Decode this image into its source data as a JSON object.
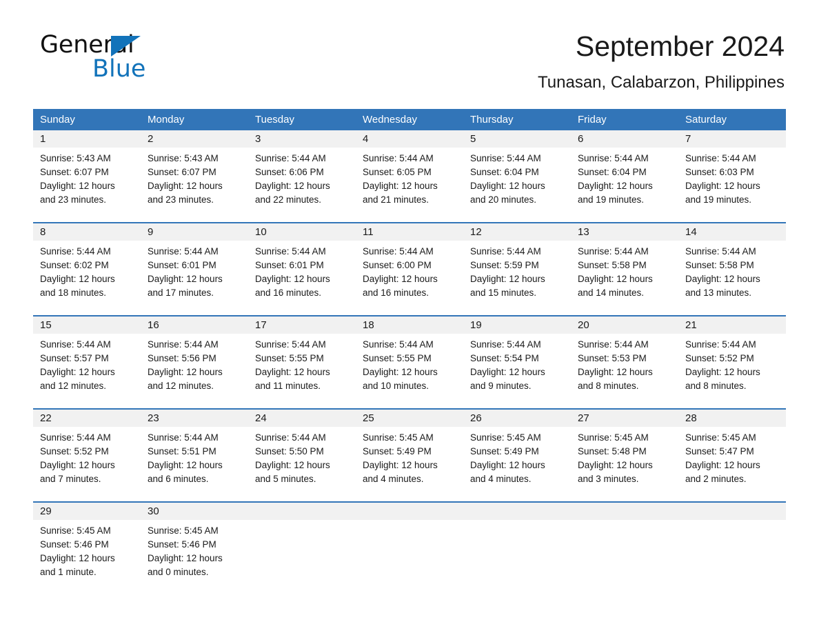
{
  "brand": {
    "name_part1": "General",
    "name_part2": "Blue",
    "triangle_color": "#1273ba"
  },
  "header": {
    "title": "September 2024",
    "subtitle": "Tunasan, Calabarzon, Philippines"
  },
  "colors": {
    "header_blue": "#3275b8",
    "daynum_band": "#f1f1f1",
    "separator_blue": "#3275b8",
    "brand_blue": "#1273ba"
  },
  "weekday_headers": [
    "Sunday",
    "Monday",
    "Tuesday",
    "Wednesday",
    "Thursday",
    "Friday",
    "Saturday"
  ],
  "weeks": [
    [
      {
        "day": "1",
        "sunrise": "Sunrise: 5:43 AM",
        "sunset": "Sunset: 6:07 PM",
        "daylight_line1": "Daylight: 12 hours",
        "daylight_line2": "and 23 minutes."
      },
      {
        "day": "2",
        "sunrise": "Sunrise: 5:43 AM",
        "sunset": "Sunset: 6:07 PM",
        "daylight_line1": "Daylight: 12 hours",
        "daylight_line2": "and 23 minutes."
      },
      {
        "day": "3",
        "sunrise": "Sunrise: 5:44 AM",
        "sunset": "Sunset: 6:06 PM",
        "daylight_line1": "Daylight: 12 hours",
        "daylight_line2": "and 22 minutes."
      },
      {
        "day": "4",
        "sunrise": "Sunrise: 5:44 AM",
        "sunset": "Sunset: 6:05 PM",
        "daylight_line1": "Daylight: 12 hours",
        "daylight_line2": "and 21 minutes."
      },
      {
        "day": "5",
        "sunrise": "Sunrise: 5:44 AM",
        "sunset": "Sunset: 6:04 PM",
        "daylight_line1": "Daylight: 12 hours",
        "daylight_line2": "and 20 minutes."
      },
      {
        "day": "6",
        "sunrise": "Sunrise: 5:44 AM",
        "sunset": "Sunset: 6:04 PM",
        "daylight_line1": "Daylight: 12 hours",
        "daylight_line2": "and 19 minutes."
      },
      {
        "day": "7",
        "sunrise": "Sunrise: 5:44 AM",
        "sunset": "Sunset: 6:03 PM",
        "daylight_line1": "Daylight: 12 hours",
        "daylight_line2": "and 19 minutes."
      }
    ],
    [
      {
        "day": "8",
        "sunrise": "Sunrise: 5:44 AM",
        "sunset": "Sunset: 6:02 PM",
        "daylight_line1": "Daylight: 12 hours",
        "daylight_line2": "and 18 minutes."
      },
      {
        "day": "9",
        "sunrise": "Sunrise: 5:44 AM",
        "sunset": "Sunset: 6:01 PM",
        "daylight_line1": "Daylight: 12 hours",
        "daylight_line2": "and 17 minutes."
      },
      {
        "day": "10",
        "sunrise": "Sunrise: 5:44 AM",
        "sunset": "Sunset: 6:01 PM",
        "daylight_line1": "Daylight: 12 hours",
        "daylight_line2": "and 16 minutes."
      },
      {
        "day": "11",
        "sunrise": "Sunrise: 5:44 AM",
        "sunset": "Sunset: 6:00 PM",
        "daylight_line1": "Daylight: 12 hours",
        "daylight_line2": "and 16 minutes."
      },
      {
        "day": "12",
        "sunrise": "Sunrise: 5:44 AM",
        "sunset": "Sunset: 5:59 PM",
        "daylight_line1": "Daylight: 12 hours",
        "daylight_line2": "and 15 minutes."
      },
      {
        "day": "13",
        "sunrise": "Sunrise: 5:44 AM",
        "sunset": "Sunset: 5:58 PM",
        "daylight_line1": "Daylight: 12 hours",
        "daylight_line2": "and 14 minutes."
      },
      {
        "day": "14",
        "sunrise": "Sunrise: 5:44 AM",
        "sunset": "Sunset: 5:58 PM",
        "daylight_line1": "Daylight: 12 hours",
        "daylight_line2": "and 13 minutes."
      }
    ],
    [
      {
        "day": "15",
        "sunrise": "Sunrise: 5:44 AM",
        "sunset": "Sunset: 5:57 PM",
        "daylight_line1": "Daylight: 12 hours",
        "daylight_line2": "and 12 minutes."
      },
      {
        "day": "16",
        "sunrise": "Sunrise: 5:44 AM",
        "sunset": "Sunset: 5:56 PM",
        "daylight_line1": "Daylight: 12 hours",
        "daylight_line2": "and 12 minutes."
      },
      {
        "day": "17",
        "sunrise": "Sunrise: 5:44 AM",
        "sunset": "Sunset: 5:55 PM",
        "daylight_line1": "Daylight: 12 hours",
        "daylight_line2": "and 11 minutes."
      },
      {
        "day": "18",
        "sunrise": "Sunrise: 5:44 AM",
        "sunset": "Sunset: 5:55 PM",
        "daylight_line1": "Daylight: 12 hours",
        "daylight_line2": "and 10 minutes."
      },
      {
        "day": "19",
        "sunrise": "Sunrise: 5:44 AM",
        "sunset": "Sunset: 5:54 PM",
        "daylight_line1": "Daylight: 12 hours",
        "daylight_line2": "and 9 minutes."
      },
      {
        "day": "20",
        "sunrise": "Sunrise: 5:44 AM",
        "sunset": "Sunset: 5:53 PM",
        "daylight_line1": "Daylight: 12 hours",
        "daylight_line2": "and 8 minutes."
      },
      {
        "day": "21",
        "sunrise": "Sunrise: 5:44 AM",
        "sunset": "Sunset: 5:52 PM",
        "daylight_line1": "Daylight: 12 hours",
        "daylight_line2": "and 8 minutes."
      }
    ],
    [
      {
        "day": "22",
        "sunrise": "Sunrise: 5:44 AM",
        "sunset": "Sunset: 5:52 PM",
        "daylight_line1": "Daylight: 12 hours",
        "daylight_line2": "and 7 minutes."
      },
      {
        "day": "23",
        "sunrise": "Sunrise: 5:44 AM",
        "sunset": "Sunset: 5:51 PM",
        "daylight_line1": "Daylight: 12 hours",
        "daylight_line2": "and 6 minutes."
      },
      {
        "day": "24",
        "sunrise": "Sunrise: 5:44 AM",
        "sunset": "Sunset: 5:50 PM",
        "daylight_line1": "Daylight: 12 hours",
        "daylight_line2": "and 5 minutes."
      },
      {
        "day": "25",
        "sunrise": "Sunrise: 5:45 AM",
        "sunset": "Sunset: 5:49 PM",
        "daylight_line1": "Daylight: 12 hours",
        "daylight_line2": "and 4 minutes."
      },
      {
        "day": "26",
        "sunrise": "Sunrise: 5:45 AM",
        "sunset": "Sunset: 5:49 PM",
        "daylight_line1": "Daylight: 12 hours",
        "daylight_line2": "and 4 minutes."
      },
      {
        "day": "27",
        "sunrise": "Sunrise: 5:45 AM",
        "sunset": "Sunset: 5:48 PM",
        "daylight_line1": "Daylight: 12 hours",
        "daylight_line2": "and 3 minutes."
      },
      {
        "day": "28",
        "sunrise": "Sunrise: 5:45 AM",
        "sunset": "Sunset: 5:47 PM",
        "daylight_line1": "Daylight: 12 hours",
        "daylight_line2": "and 2 minutes."
      }
    ],
    [
      {
        "day": "29",
        "sunrise": "Sunrise: 5:45 AM",
        "sunset": "Sunset: 5:46 PM",
        "daylight_line1": "Daylight: 12 hours",
        "daylight_line2": "and 1 minute."
      },
      {
        "day": "30",
        "sunrise": "Sunrise: 5:45 AM",
        "sunset": "Sunset: 5:46 PM",
        "daylight_line1": "Daylight: 12 hours",
        "daylight_line2": "and 0 minutes."
      },
      {
        "day": "",
        "sunrise": "",
        "sunset": "",
        "daylight_line1": "",
        "daylight_line2": ""
      },
      {
        "day": "",
        "sunrise": "",
        "sunset": "",
        "daylight_line1": "",
        "daylight_line2": ""
      },
      {
        "day": "",
        "sunrise": "",
        "sunset": "",
        "daylight_line1": "",
        "daylight_line2": ""
      },
      {
        "day": "",
        "sunrise": "",
        "sunset": "",
        "daylight_line1": "",
        "daylight_line2": ""
      },
      {
        "day": "",
        "sunrise": "",
        "sunset": "",
        "daylight_line1": "",
        "daylight_line2": ""
      }
    ]
  ]
}
